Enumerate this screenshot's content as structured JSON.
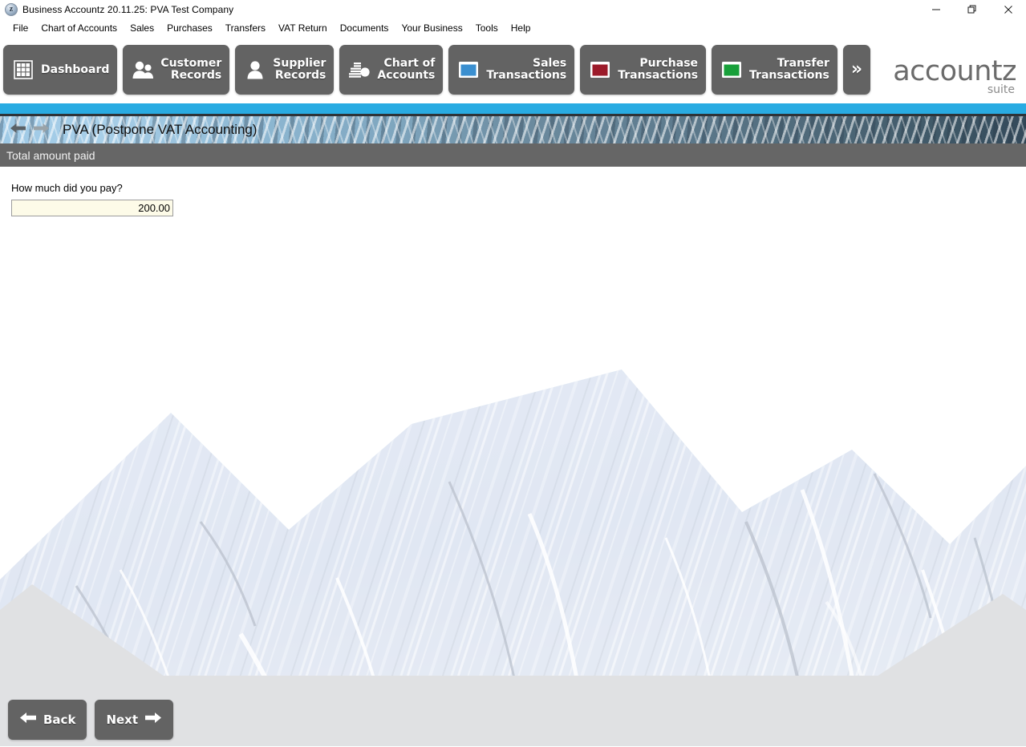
{
  "window": {
    "title": "Business Accountz 20.11.25: PVA Test Company",
    "app_icon": "accountz-app-icon",
    "controls": {
      "minimize": "minimize-icon",
      "restore": "restore-icon",
      "close": "close-icon"
    }
  },
  "menubar": {
    "items": [
      {
        "label": "File"
      },
      {
        "label": "Chart of Accounts"
      },
      {
        "label": "Sales"
      },
      {
        "label": "Purchases"
      },
      {
        "label": "Transfers"
      },
      {
        "label": "VAT Return"
      },
      {
        "label": "Documents"
      },
      {
        "label": "Your Business"
      },
      {
        "label": "Tools"
      },
      {
        "label": "Help"
      }
    ]
  },
  "toolbar": {
    "buttons": [
      {
        "label": "Dashboard",
        "icon": "grid-dashboard-icon",
        "single_line": true
      },
      {
        "label": "Customer\nRecords",
        "icon": "two-people-icon",
        "single_line": false
      },
      {
        "label": "Supplier\nRecords",
        "icon": "single-person-icon",
        "single_line": false
      },
      {
        "label": "Chart of\nAccounts",
        "icon": "bar-chart-icon",
        "single_line": false
      },
      {
        "label": "Sales\nTransactions",
        "icon": "blue-book-icon",
        "single_line": false
      },
      {
        "label": "Purchase\nTransactions",
        "icon": "red-book-icon",
        "single_line": false
      },
      {
        "label": "Transfer\nTransactions",
        "icon": "green-book-icon",
        "single_line": false
      }
    ],
    "overflow_label": "»",
    "overflow_icon": "double-chevron-right-icon"
  },
  "brand": {
    "name": "accountz",
    "tagline": "suite"
  },
  "banner": {
    "back_icon": "arrow-left-icon",
    "forward_icon": "arrow-right-icon",
    "title": "PVA (Postpone VAT Accounting)",
    "stripe_color": "#29abe2"
  },
  "section": {
    "title": "Total amount paid",
    "background_color": "#666666"
  },
  "form": {
    "question_label": "How much did you pay?",
    "amount_value": "200.00",
    "amount_placeholder": "",
    "field_background_color": "#fdfbe8"
  },
  "footer": {
    "back_label": "Back",
    "back_icon": "arrow-left-icon",
    "next_label": "Next",
    "next_icon": "arrow-right-icon",
    "background_color": "#e0e1e3"
  }
}
